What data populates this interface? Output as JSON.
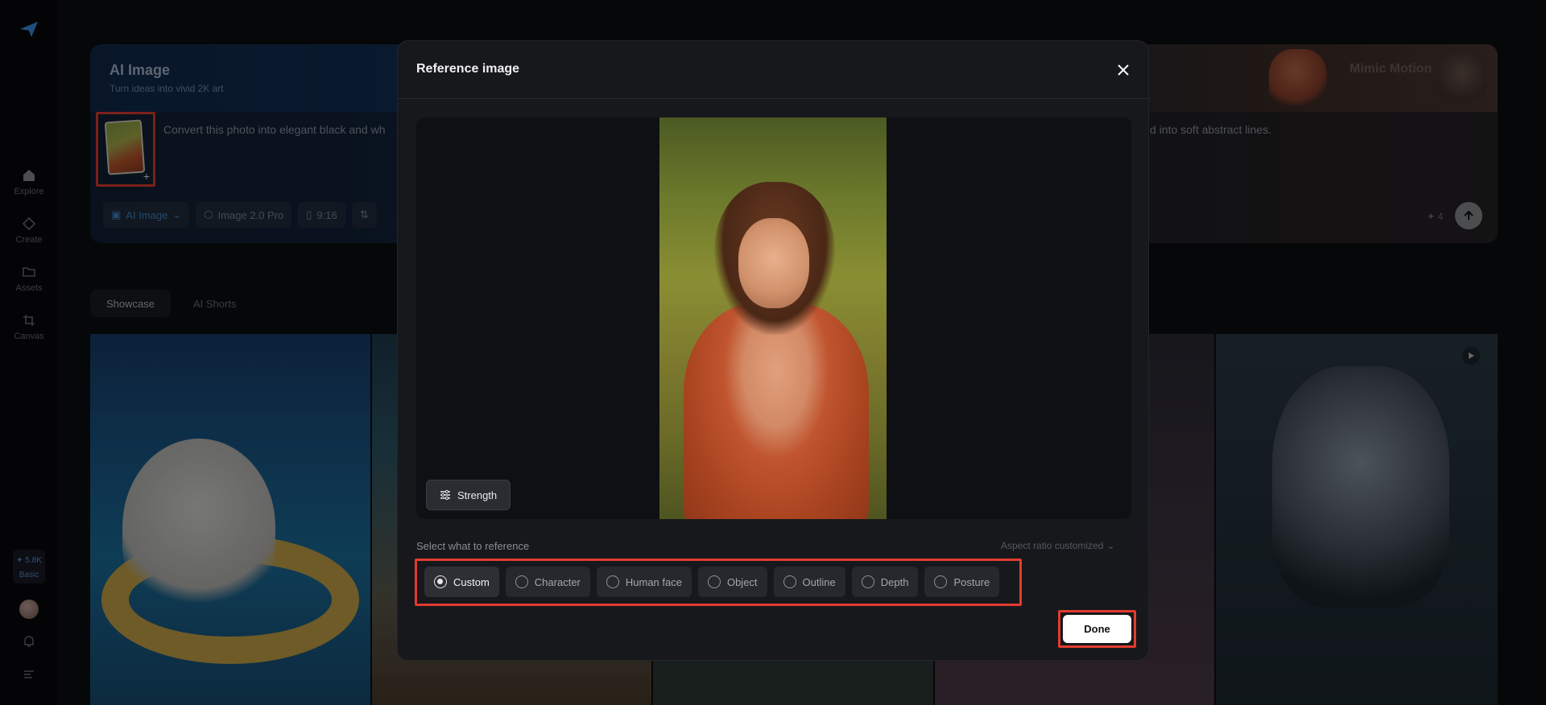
{
  "sidebar": {
    "nav": [
      {
        "label": "Explore",
        "icon": "home-icon"
      },
      {
        "label": "Create",
        "icon": "diamond-icon"
      },
      {
        "label": "Assets",
        "icon": "folder-icon"
      },
      {
        "label": "Canvas",
        "icon": "crop-icon"
      }
    ],
    "credits": "5.8K",
    "plan": "Basic"
  },
  "hero": {
    "title": "AI Image",
    "subtitle": "Turn ideas into vivid 2K art",
    "prompt_start": "Convert this photo into elegant black and wh",
    "prompt_end": "d into soft abstract lines.",
    "chips": [
      "AI Image",
      "Image 2.0 Pro",
      "9:16"
    ],
    "count": "4",
    "mimic_label": "Mimic Motion"
  },
  "tabs": [
    "Showcase",
    "AI Shorts"
  ],
  "modal": {
    "title": "Reference image",
    "strength_label": "Strength",
    "select_label": "Select what to reference",
    "aspect_label": "Aspect ratio customized",
    "options": [
      "Custom",
      "Character",
      "Human face",
      "Object",
      "Outline",
      "Depth",
      "Posture"
    ],
    "selected_option": "Custom",
    "done_label": "Done"
  },
  "colors": {
    "highlight": "#e23b2e",
    "accent": "#3e86c6",
    "modal_bg": "#17181c"
  }
}
